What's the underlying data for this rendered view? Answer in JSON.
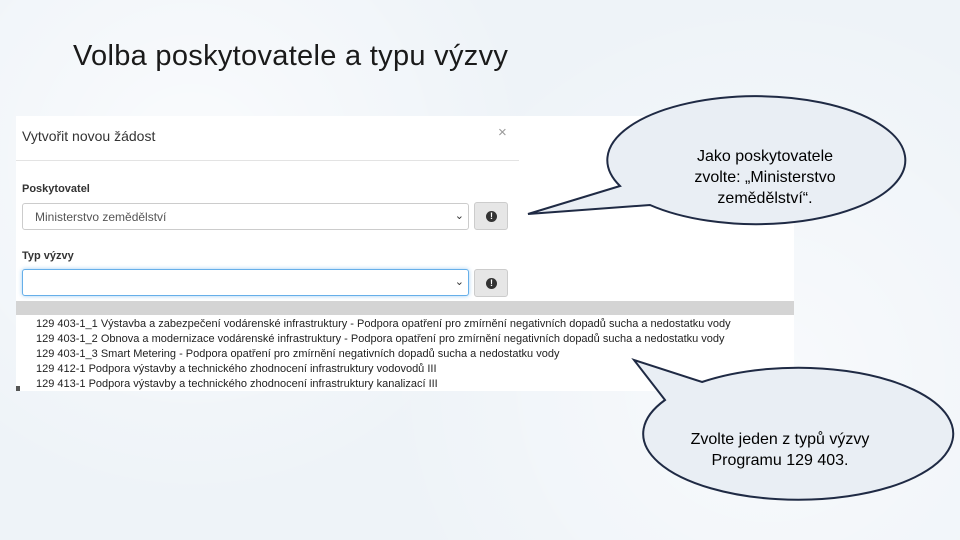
{
  "slide": {
    "title": "Volba poskytovatele a typu výzvy"
  },
  "modal": {
    "title": "Vytvořit novou žádost",
    "close_glyph": "×",
    "provider": {
      "label": "Poskytovatel",
      "value": "Ministerstvo zemědělství"
    },
    "call_type": {
      "label": "Typ výzvy",
      "value": ""
    },
    "info_glyph": "!",
    "chevron_glyph": "⌄",
    "options": [
      "129 403-1_1 Výstavba a zabezpečení vodárenské infrastruktury - Podpora opatření pro zmírnění negativních dopadů sucha a nedostatku vody",
      "129 403-1_2 Obnova a modernizace vodárenské infrastruktury - Podpora opatření pro zmírnění negativních dopadů sucha a nedostatku vody",
      "129 403-1_3 Smart Metering - Podpora opatření pro zmírnění negativních dopadů sucha a nedostatku vody",
      "129 412-1 Podpora výstavby a technického zhodnocení infrastruktury vodovodů III",
      "129 413-1 Podpora výstavby a technického zhodnocení infrastruktury kanalizací III"
    ]
  },
  "callouts": {
    "provider_hint": [
      "Jako poskytovatele",
      "zvolte: „Ministerstvo",
      "zemědělství“."
    ],
    "type_hint": [
      "Zvolte jeden z typů výzvy",
      "Programu 129 403."
    ]
  },
  "colors": {
    "bubble_fill": "#e9eef4",
    "bubble_stroke": "#1f2a44"
  }
}
